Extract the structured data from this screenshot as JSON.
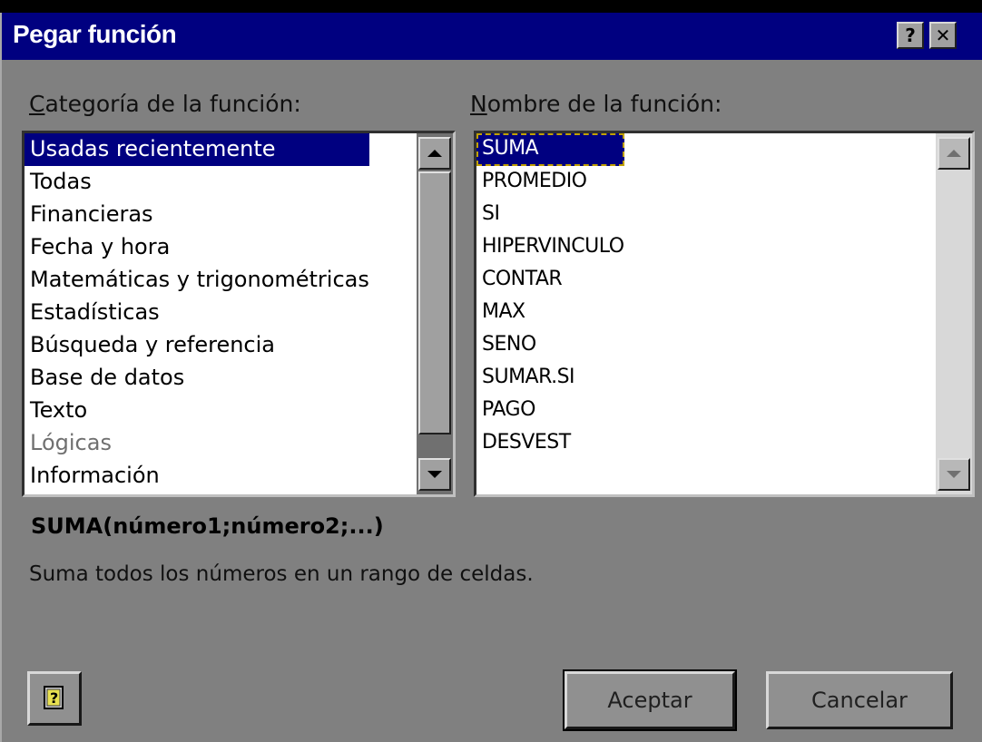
{
  "window": {
    "title": "Pegar función",
    "help_glyph": "?",
    "close_glyph": "✕"
  },
  "category": {
    "label_accel": "C",
    "label_rest": "ategoría de la función:",
    "items": [
      "Usadas recientemente",
      "Todas",
      "Financieras",
      "Fecha y hora",
      "Matemáticas y trigonométricas",
      "Estadísticas",
      "Búsqueda y referencia",
      "Base de datos",
      "Texto",
      "Lógicas",
      "Información"
    ],
    "selected": "Usadas recientemente"
  },
  "function": {
    "label_accel": "N",
    "label_rest": "ombre de la función:",
    "items": [
      "SUMA",
      "PROMEDIO",
      "SI",
      "HIPERVINCULO",
      "CONTAR",
      "MAX",
      "SENO",
      "SUMAR.SI",
      "PAGO",
      "DESVEST"
    ],
    "selected": "SUMA"
  },
  "signature": "SUMA(número1;número2;...)",
  "description": "Suma todos los números en un rango de celdas.",
  "buttons": {
    "ok": "Aceptar",
    "cancel": "Cancelar",
    "help_glyph": "?"
  },
  "colors": {
    "title_bar": "#000080",
    "selection": "#000080",
    "dialog_face": "#808080"
  }
}
